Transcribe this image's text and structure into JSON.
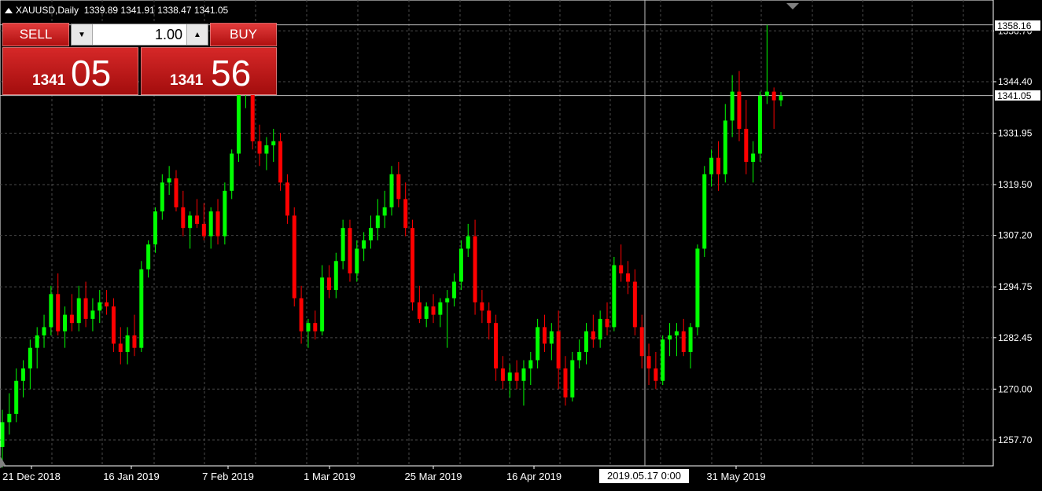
{
  "header": {
    "symbol_label": "XAUUSD,Daily",
    "ohlc": "1339.89 1341.91 1338.47 1341.05"
  },
  "trade_panel": {
    "sell_label": "SELL",
    "buy_label": "BUY",
    "lot_value": "1.00",
    "sell_small": "1341",
    "sell_big": "05",
    "buy_small": "1341",
    "buy_big": "56"
  },
  "axis": {
    "price_labels": [
      "1356.70",
      "1344.40",
      "1331.95",
      "1319.50",
      "1307.20",
      "1294.75",
      "1282.45",
      "1270.00",
      "1257.70"
    ],
    "high_tag": "1358.16",
    "current_tag": "1341.05",
    "date_labels": [
      "21 Dec 2018",
      "16 Jan 2019",
      "7 Feb 2019",
      "1 Mar 2019",
      "25 Mar 2019",
      "16 Apr 2019",
      "31 May 2019"
    ],
    "cursor_date": "2019.05.17 0:00"
  },
  "colors": {
    "bull": "#00ff00",
    "bear": "#ff0000",
    "grid": "#4a4a4a",
    "background": "#000000"
  },
  "chart_data": {
    "type": "candlestick",
    "symbol": "XAUUSD",
    "timeframe": "Daily",
    "ylim": [
      1250,
      1362
    ],
    "candles": [
      [
        1256.0,
        1265.0,
        1251.0,
        1262.0
      ],
      [
        1262.0,
        1269.0,
        1259.0,
        1264.0
      ],
      [
        1264.0,
        1275.0,
        1262.0,
        1272.0
      ],
      [
        1272.0,
        1277.0,
        1268.0,
        1275.0
      ],
      [
        1275.0,
        1282.0,
        1270.0,
        1280.0
      ],
      [
        1280.0,
        1285.0,
        1275.0,
        1283.0
      ],
      [
        1283.0,
        1288.0,
        1280.0,
        1285.0
      ],
      [
        1285.0,
        1295.0,
        1283.0,
        1293.0
      ],
      [
        1293.0,
        1298.0,
        1283.0,
        1284.0
      ],
      [
        1284.0,
        1290.0,
        1280.0,
        1288.0
      ],
      [
        1288.0,
        1293.0,
        1284.0,
        1286.0
      ],
      [
        1286.0,
        1295.0,
        1284.0,
        1292.0
      ],
      [
        1292.0,
        1296.0,
        1285.0,
        1287.0
      ],
      [
        1287.0,
        1292.0,
        1284.0,
        1289.0
      ],
      [
        1289.0,
        1294.0,
        1286.0,
        1291.0
      ],
      [
        1291.0,
        1294.0,
        1288.0,
        1290.0
      ],
      [
        1290.0,
        1292.0,
        1279.0,
        1281.0
      ],
      [
        1281.0,
        1285.0,
        1276.0,
        1279.0
      ],
      [
        1279.0,
        1285.0,
        1276.0,
        1283.0
      ],
      [
        1283.0,
        1288.0,
        1278.0,
        1280.0
      ],
      [
        1280.0,
        1301.0,
        1279.0,
        1299.0
      ],
      [
        1299.0,
        1306.0,
        1297.0,
        1305.0
      ],
      [
        1305.0,
        1314.0,
        1303.0,
        1313.0
      ],
      [
        1313.0,
        1322.0,
        1311.0,
        1320.0
      ],
      [
        1320.0,
        1324.0,
        1317.0,
        1321.0
      ],
      [
        1321.0,
        1323.0,
        1313.0,
        1314.0
      ],
      [
        1314.0,
        1318.0,
        1307.0,
        1309.0
      ],
      [
        1309.0,
        1313.0,
        1304.0,
        1312.0
      ],
      [
        1312.0,
        1316.0,
        1309.0,
        1310.0
      ],
      [
        1310.0,
        1315.0,
        1306.0,
        1307.0
      ],
      [
        1307.0,
        1314.0,
        1304.0,
        1313.0
      ],
      [
        1313.0,
        1316.0,
        1305.0,
        1307.0
      ],
      [
        1307.0,
        1320.0,
        1305.0,
        1318.0
      ],
      [
        1318.0,
        1328.0,
        1316.0,
        1327.0
      ],
      [
        1327.0,
        1345.0,
        1325.0,
        1342.0
      ],
      [
        1342.0,
        1350.0,
        1338.0,
        1343.0
      ],
      [
        1343.0,
        1346.0,
        1328.0,
        1330.0
      ],
      [
        1330.0,
        1334.0,
        1324.0,
        1327.0
      ],
      [
        1327.0,
        1331.0,
        1323.0,
        1329.0
      ],
      [
        1329.0,
        1333.0,
        1325.0,
        1330.0
      ],
      [
        1330.0,
        1332.0,
        1318.0,
        1320.0
      ],
      [
        1320.0,
        1322.0,
        1310.0,
        1312.0
      ],
      [
        1312.0,
        1314.0,
        1290.0,
        1292.0
      ],
      [
        1292.0,
        1295.0,
        1281.0,
        1284.0
      ],
      [
        1284.0,
        1287.0,
        1280.0,
        1286.0
      ],
      [
        1286.0,
        1289.0,
        1282.0,
        1284.0
      ],
      [
        1284.0,
        1300.0,
        1283.0,
        1297.0
      ],
      [
        1297.0,
        1300.0,
        1292.0,
        1294.0
      ],
      [
        1294.0,
        1303.0,
        1292.0,
        1301.0
      ],
      [
        1301.0,
        1311.0,
        1299.0,
        1309.0
      ],
      [
        1309.0,
        1311.0,
        1296.0,
        1298.0
      ],
      [
        1298.0,
        1306.0,
        1296.0,
        1304.0
      ],
      [
        1304.0,
        1308.0,
        1301.0,
        1306.0
      ],
      [
        1306.0,
        1312.0,
        1304.0,
        1309.0
      ],
      [
        1309.0,
        1316.0,
        1306.0,
        1312.0
      ],
      [
        1312.0,
        1318.0,
        1309.0,
        1314.0
      ],
      [
        1314.0,
        1324.0,
        1312.0,
        1322.0
      ],
      [
        1322.0,
        1325.0,
        1314.0,
        1316.0
      ],
      [
        1316.0,
        1320.0,
        1307.0,
        1309.0
      ],
      [
        1309.0,
        1311.0,
        1289.0,
        1291.0
      ],
      [
        1291.0,
        1295.0,
        1286.0,
        1287.0
      ],
      [
        1287.0,
        1291.0,
        1285.0,
        1290.0
      ],
      [
        1290.0,
        1293.0,
        1286.0,
        1288.0
      ],
      [
        1288.0,
        1292.0,
        1285.0,
        1291.0
      ],
      [
        1291.0,
        1294.0,
        1280.0,
        1292.0
      ],
      [
        1292.0,
        1298.0,
        1290.0,
        1296.0
      ],
      [
        1296.0,
        1306.0,
        1294.0,
        1304.0
      ],
      [
        1304.0,
        1310.0,
        1302.0,
        1307.0
      ],
      [
        1307.0,
        1311.0,
        1288.0,
        1291.0
      ],
      [
        1291.0,
        1294.0,
        1286.0,
        1289.0
      ],
      [
        1289.0,
        1291.0,
        1282.0,
        1286.0
      ],
      [
        1286.0,
        1288.0,
        1272.0,
        1275.0
      ],
      [
        1275.0,
        1278.0,
        1270.0,
        1272.0
      ],
      [
        1272.0,
        1276.0,
        1268.0,
        1274.0
      ],
      [
        1274.0,
        1277.0,
        1270.0,
        1272.0
      ],
      [
        1272.0,
        1277.0,
        1266.0,
        1275.0
      ],
      [
        1275.0,
        1279.0,
        1271.0,
        1277.0
      ],
      [
        1277.0,
        1287.0,
        1275.0,
        1285.0
      ],
      [
        1285.0,
        1288.0,
        1279.0,
        1281.0
      ],
      [
        1281.0,
        1286.0,
        1277.0,
        1284.0
      ],
      [
        1284.0,
        1289.0,
        1270.0,
        1275.0
      ],
      [
        1275.0,
        1278.0,
        1266.0,
        1268.0
      ],
      [
        1268.0,
        1279.0,
        1267.0,
        1277.0
      ],
      [
        1277.0,
        1282.0,
        1275.0,
        1279.0
      ],
      [
        1279.0,
        1286.0,
        1276.0,
        1284.0
      ],
      [
        1284.0,
        1288.0,
        1280.0,
        1282.0
      ],
      [
        1282.0,
        1289.0,
        1280.0,
        1287.0
      ],
      [
        1287.0,
        1291.0,
        1283.0,
        1285.0
      ],
      [
        1285.0,
        1302.0,
        1284.0,
        1300.0
      ],
      [
        1300.0,
        1305.0,
        1296.0,
        1298.0
      ],
      [
        1298.0,
        1301.0,
        1293.0,
        1296.0
      ],
      [
        1296.0,
        1299.0,
        1283.0,
        1285.0
      ],
      [
        1285.0,
        1288.0,
        1275.0,
        1278.0
      ],
      [
        1278.0,
        1281.0,
        1271.0,
        1275.0
      ],
      [
        1275.0,
        1279.0,
        1270.0,
        1272.0
      ],
      [
        1272.0,
        1283.0,
        1271.0,
        1282.0
      ],
      [
        1282.0,
        1286.0,
        1278.0,
        1283.0
      ],
      [
        1283.0,
        1286.0,
        1278.0,
        1284.0
      ],
      [
        1284.0,
        1287.0,
        1278.0,
        1279.0
      ],
      [
        1279.0,
        1286.0,
        1275.0,
        1285.0
      ],
      [
        1285.0,
        1305.0,
        1283.0,
        1304.0
      ],
      [
        1304.0,
        1324.0,
        1302.0,
        1322.0
      ],
      [
        1322.0,
        1328.0,
        1319.0,
        1326.0
      ],
      [
        1326.0,
        1330.0,
        1318.0,
        1322.0
      ],
      [
        1322.0,
        1339.0,
        1320.0,
        1335.0
      ],
      [
        1335.0,
        1346.0,
        1331.0,
        1342.0
      ],
      [
        1342.0,
        1347.0,
        1330.0,
        1333.0
      ],
      [
        1333.0,
        1340.0,
        1322.0,
        1325.0
      ],
      [
        1325.0,
        1330.0,
        1320.0,
        1327.0
      ],
      [
        1327.0,
        1342.0,
        1325.0,
        1341.0
      ],
      [
        1341.0,
        1358.16,
        1339.0,
        1342.0
      ],
      [
        1342.0,
        1343.0,
        1333.0,
        1339.89
      ],
      [
        1339.89,
        1341.91,
        1338.47,
        1341.05
      ]
    ]
  }
}
